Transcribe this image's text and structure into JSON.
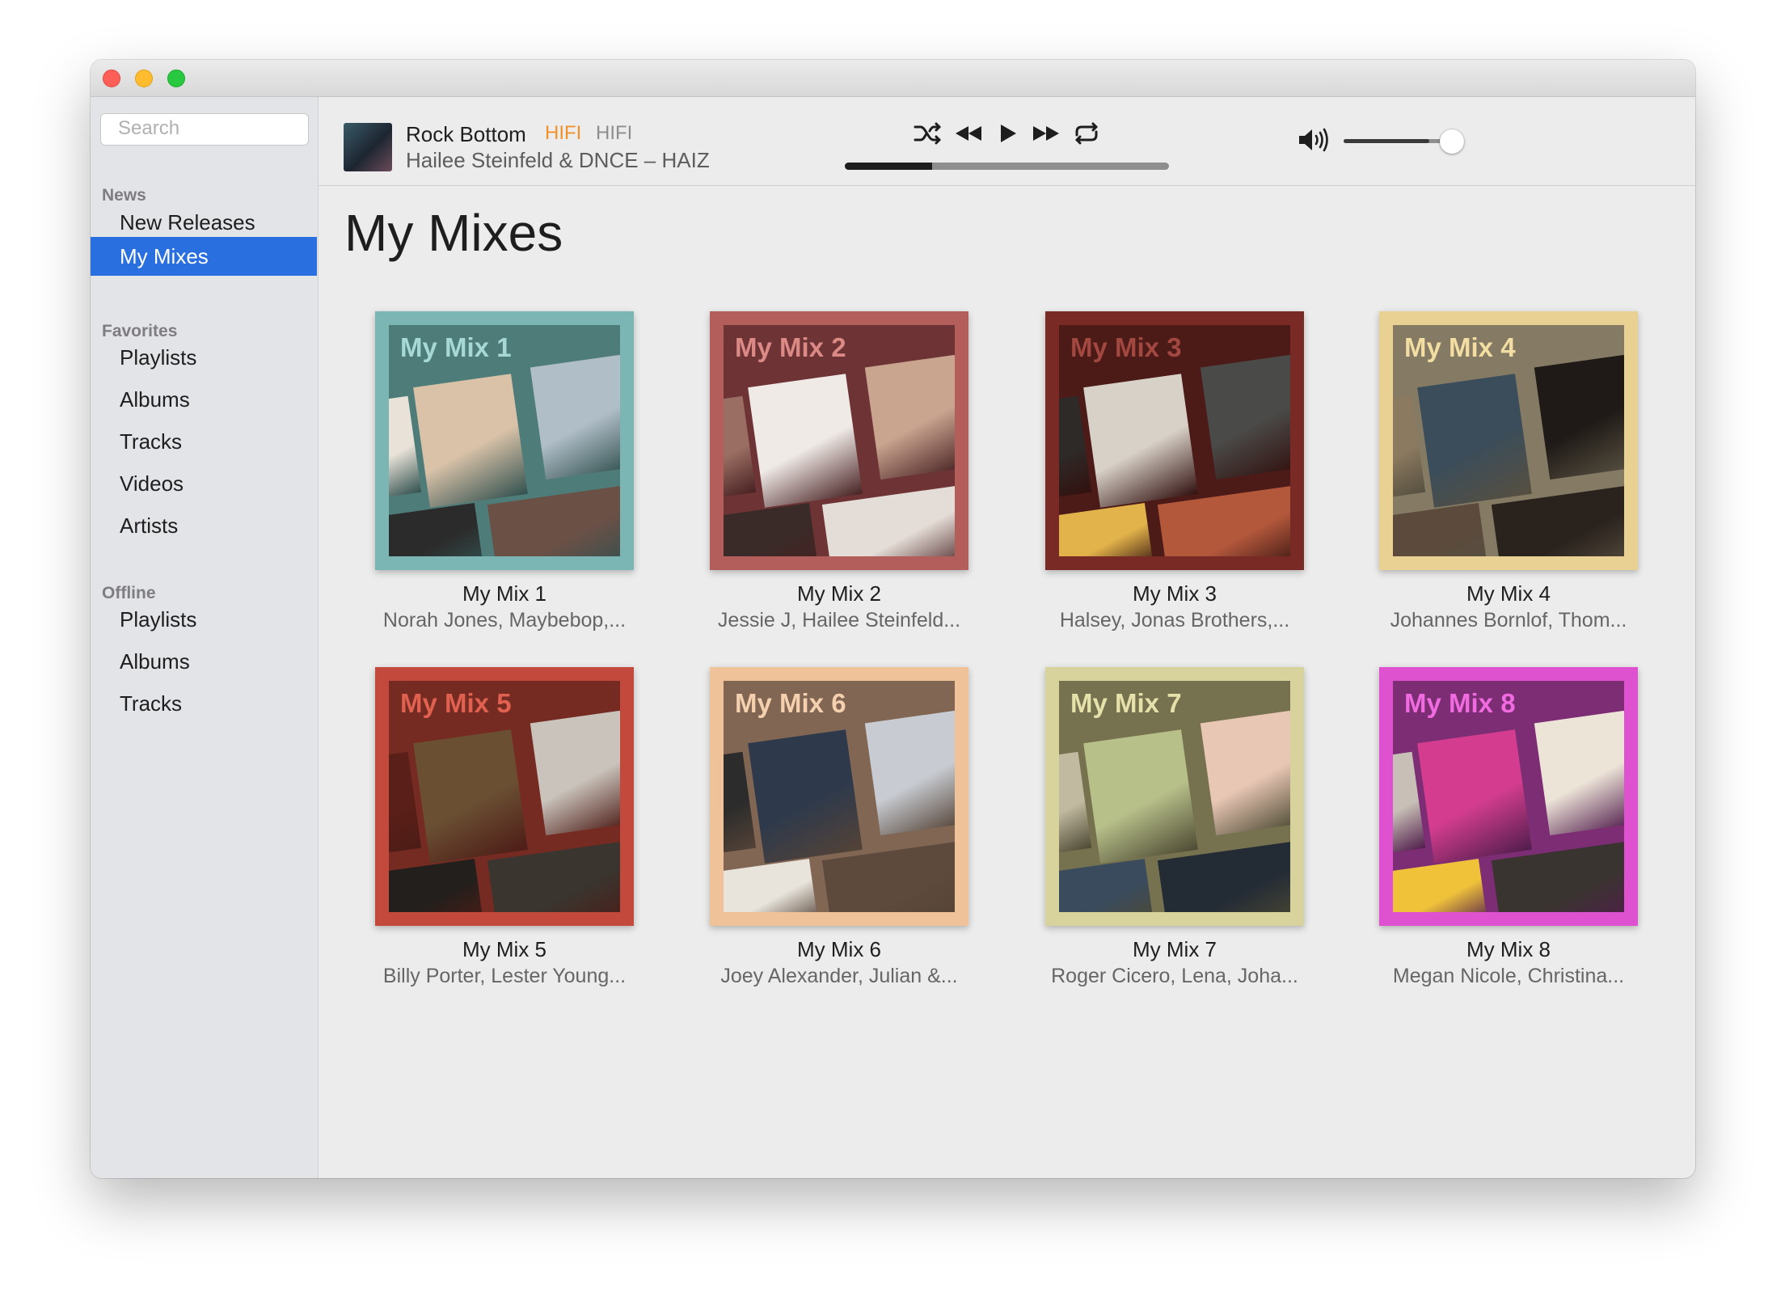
{
  "sidebar": {
    "search_placeholder": "Search",
    "sections": [
      {
        "title": "News",
        "items": [
          "New Releases",
          "My Mixes"
        ]
      },
      {
        "title": "Favorites",
        "items": [
          "Playlists",
          "Albums",
          "Tracks",
          "Videos",
          "Artists"
        ]
      },
      {
        "title": "Offline",
        "items": [
          "Playlists",
          "Albums",
          "Tracks"
        ]
      }
    ],
    "active_item": "My Mixes"
  },
  "player": {
    "track_title": "Rock Bottom",
    "quality_badge_1": "HIFI",
    "quality_badge_2": "HIFI",
    "artist_line": "Hailee Steinfeld & DNCE – HAIZ",
    "progress": 0.27,
    "volume": 0.75,
    "icons": {
      "shuffle": "shuffle-icon",
      "previous": "previous-icon",
      "play": "play-icon",
      "next": "next-icon",
      "repeat": "repeat-icon",
      "volume": "volume-icon",
      "lyrics": "lyrics-icon",
      "queue": "queue-list-icon"
    }
  },
  "main": {
    "title": "My Mixes",
    "mixes": [
      {
        "label": "My Mix 1",
        "title": "My Mix 1",
        "artists": "Norah Jones, Maybebop,...",
        "frame": "#7bb5b4",
        "bg": "#4e7c79",
        "text": "#a6d8d5"
      },
      {
        "label": "My Mix 2",
        "title": "My Mix 2",
        "artists": "Jessie J, Hailee Steinfeld...",
        "frame": "#b45e5c",
        "bg": "#6e3335",
        "text": "#dc8a86"
      },
      {
        "label": "My Mix 3",
        "title": "My Mix 3",
        "artists": "Halsey, Jonas Brothers,...",
        "frame": "#7a2a24",
        "bg": "#4c1a17",
        "text": "#a24840"
      },
      {
        "label": "My Mix 4",
        "title": "My Mix 4",
        "artists": "Johannes Bornlof, Thom...",
        "frame": "#e9d194",
        "bg": "#857a63",
        "text": "#f2dea2"
      },
      {
        "label": "My Mix 5",
        "title": "My Mix 5",
        "artists": "Billy Porter, Lester Young...",
        "frame": "#c2493b",
        "bg": "#762b22",
        "text": "#e0614f"
      },
      {
        "label": "My Mix 6",
        "title": "My Mix 6",
        "artists": "Joey Alexander, Julian &...",
        "frame": "#efc29a",
        "bg": "#816654",
        "text": "#f4d0ae"
      },
      {
        "label": "My Mix 7",
        "title": "My Mix 7",
        "artists": "Roger Cicero, Lena, Joha...",
        "frame": "#d8d29c",
        "bg": "#76714e",
        "text": "#e6e0ab"
      },
      {
        "label": "My Mix 8",
        "title": "My Mix 8",
        "artists": "Megan Nicole, Christina...",
        "frame": "#df52cf",
        "bg": "#7c2d74",
        "text": "#f06ae0"
      }
    ]
  }
}
